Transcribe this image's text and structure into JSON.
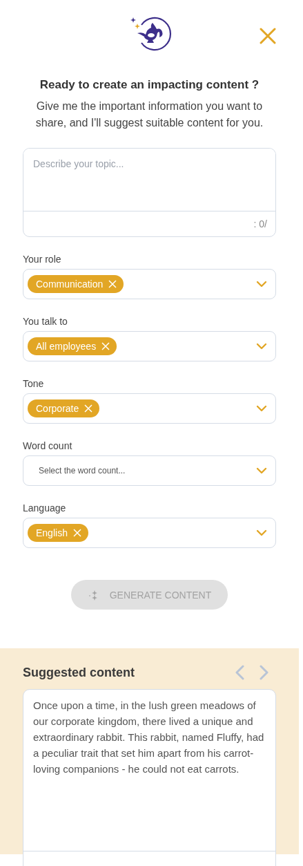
{
  "header": {
    "title": "Ready to create an impacting content ?",
    "subtitle": "Give me the important information you want to share, and I'll suggest suitable content for you."
  },
  "topic": {
    "placeholder": "Describe your topic...",
    "counter": ": 0/"
  },
  "fields": [
    {
      "label": "Your role",
      "chips": [
        "Communication"
      ]
    },
    {
      "label": "You talk to",
      "chips": [
        "All employees"
      ]
    },
    {
      "label": "Tone",
      "chips": [
        "Corporate"
      ]
    },
    {
      "label": "Word count",
      "placeholder": "Select the word count..."
    },
    {
      "label": "Language",
      "chips": [
        "English"
      ]
    }
  ],
  "generate_button": {
    "label": "GENERATE CONTENT",
    "disabled": true
  },
  "suggested": {
    "title": "Suggested content",
    "text": "Once upon a time, in the lush green meadows of our corporate kingdom, there lived a unique and extraordinary rabbit. This rabbit, named Fluffy, had a peculiar trait that set him apart from his carrot-loving companions - he could not eat carrots."
  }
}
